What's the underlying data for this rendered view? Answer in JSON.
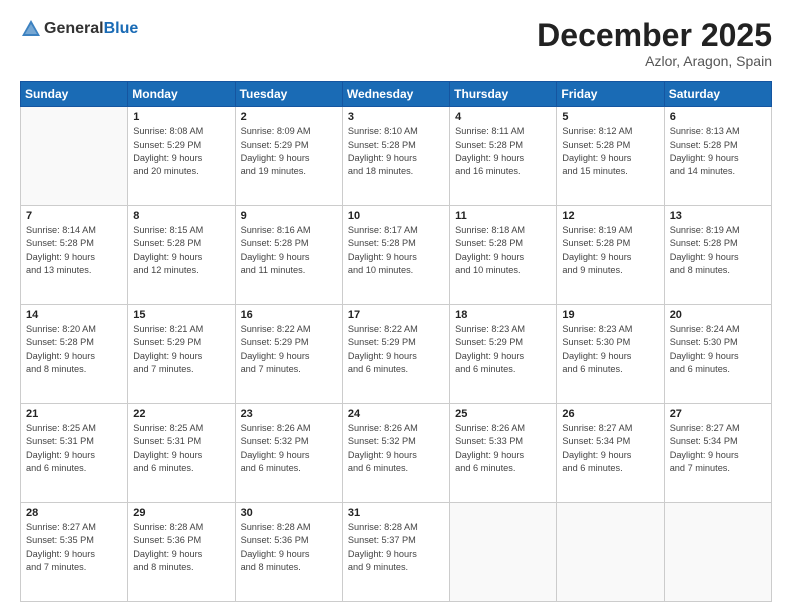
{
  "header": {
    "logo_line1": "General",
    "logo_line2": "Blue",
    "month": "December 2025",
    "location": "Azlor, Aragon, Spain"
  },
  "days_of_week": [
    "Sunday",
    "Monday",
    "Tuesday",
    "Wednesday",
    "Thursday",
    "Friday",
    "Saturday"
  ],
  "weeks": [
    [
      {
        "day": "",
        "info": ""
      },
      {
        "day": "1",
        "info": "Sunrise: 8:08 AM\nSunset: 5:29 PM\nDaylight: 9 hours\nand 20 minutes."
      },
      {
        "day": "2",
        "info": "Sunrise: 8:09 AM\nSunset: 5:29 PM\nDaylight: 9 hours\nand 19 minutes."
      },
      {
        "day": "3",
        "info": "Sunrise: 8:10 AM\nSunset: 5:28 PM\nDaylight: 9 hours\nand 18 minutes."
      },
      {
        "day": "4",
        "info": "Sunrise: 8:11 AM\nSunset: 5:28 PM\nDaylight: 9 hours\nand 16 minutes."
      },
      {
        "day": "5",
        "info": "Sunrise: 8:12 AM\nSunset: 5:28 PM\nDaylight: 9 hours\nand 15 minutes."
      },
      {
        "day": "6",
        "info": "Sunrise: 8:13 AM\nSunset: 5:28 PM\nDaylight: 9 hours\nand 14 minutes."
      }
    ],
    [
      {
        "day": "7",
        "info": "Sunrise: 8:14 AM\nSunset: 5:28 PM\nDaylight: 9 hours\nand 13 minutes."
      },
      {
        "day": "8",
        "info": "Sunrise: 8:15 AM\nSunset: 5:28 PM\nDaylight: 9 hours\nand 12 minutes."
      },
      {
        "day": "9",
        "info": "Sunrise: 8:16 AM\nSunset: 5:28 PM\nDaylight: 9 hours\nand 11 minutes."
      },
      {
        "day": "10",
        "info": "Sunrise: 8:17 AM\nSunset: 5:28 PM\nDaylight: 9 hours\nand 10 minutes."
      },
      {
        "day": "11",
        "info": "Sunrise: 8:18 AM\nSunset: 5:28 PM\nDaylight: 9 hours\nand 10 minutes."
      },
      {
        "day": "12",
        "info": "Sunrise: 8:19 AM\nSunset: 5:28 PM\nDaylight: 9 hours\nand 9 minutes."
      },
      {
        "day": "13",
        "info": "Sunrise: 8:19 AM\nSunset: 5:28 PM\nDaylight: 9 hours\nand 8 minutes."
      }
    ],
    [
      {
        "day": "14",
        "info": "Sunrise: 8:20 AM\nSunset: 5:28 PM\nDaylight: 9 hours\nand 8 minutes."
      },
      {
        "day": "15",
        "info": "Sunrise: 8:21 AM\nSunset: 5:29 PM\nDaylight: 9 hours\nand 7 minutes."
      },
      {
        "day": "16",
        "info": "Sunrise: 8:22 AM\nSunset: 5:29 PM\nDaylight: 9 hours\nand 7 minutes."
      },
      {
        "day": "17",
        "info": "Sunrise: 8:22 AM\nSunset: 5:29 PM\nDaylight: 9 hours\nand 6 minutes."
      },
      {
        "day": "18",
        "info": "Sunrise: 8:23 AM\nSunset: 5:29 PM\nDaylight: 9 hours\nand 6 minutes."
      },
      {
        "day": "19",
        "info": "Sunrise: 8:23 AM\nSunset: 5:30 PM\nDaylight: 9 hours\nand 6 minutes."
      },
      {
        "day": "20",
        "info": "Sunrise: 8:24 AM\nSunset: 5:30 PM\nDaylight: 9 hours\nand 6 minutes."
      }
    ],
    [
      {
        "day": "21",
        "info": "Sunrise: 8:25 AM\nSunset: 5:31 PM\nDaylight: 9 hours\nand 6 minutes."
      },
      {
        "day": "22",
        "info": "Sunrise: 8:25 AM\nSunset: 5:31 PM\nDaylight: 9 hours\nand 6 minutes."
      },
      {
        "day": "23",
        "info": "Sunrise: 8:26 AM\nSunset: 5:32 PM\nDaylight: 9 hours\nand 6 minutes."
      },
      {
        "day": "24",
        "info": "Sunrise: 8:26 AM\nSunset: 5:32 PM\nDaylight: 9 hours\nand 6 minutes."
      },
      {
        "day": "25",
        "info": "Sunrise: 8:26 AM\nSunset: 5:33 PM\nDaylight: 9 hours\nand 6 minutes."
      },
      {
        "day": "26",
        "info": "Sunrise: 8:27 AM\nSunset: 5:34 PM\nDaylight: 9 hours\nand 6 minutes."
      },
      {
        "day": "27",
        "info": "Sunrise: 8:27 AM\nSunset: 5:34 PM\nDaylight: 9 hours\nand 7 minutes."
      }
    ],
    [
      {
        "day": "28",
        "info": "Sunrise: 8:27 AM\nSunset: 5:35 PM\nDaylight: 9 hours\nand 7 minutes."
      },
      {
        "day": "29",
        "info": "Sunrise: 8:28 AM\nSunset: 5:36 PM\nDaylight: 9 hours\nand 8 minutes."
      },
      {
        "day": "30",
        "info": "Sunrise: 8:28 AM\nSunset: 5:36 PM\nDaylight: 9 hours\nand 8 minutes."
      },
      {
        "day": "31",
        "info": "Sunrise: 8:28 AM\nSunset: 5:37 PM\nDaylight: 9 hours\nand 9 minutes."
      },
      {
        "day": "",
        "info": ""
      },
      {
        "day": "",
        "info": ""
      },
      {
        "day": "",
        "info": ""
      }
    ]
  ]
}
